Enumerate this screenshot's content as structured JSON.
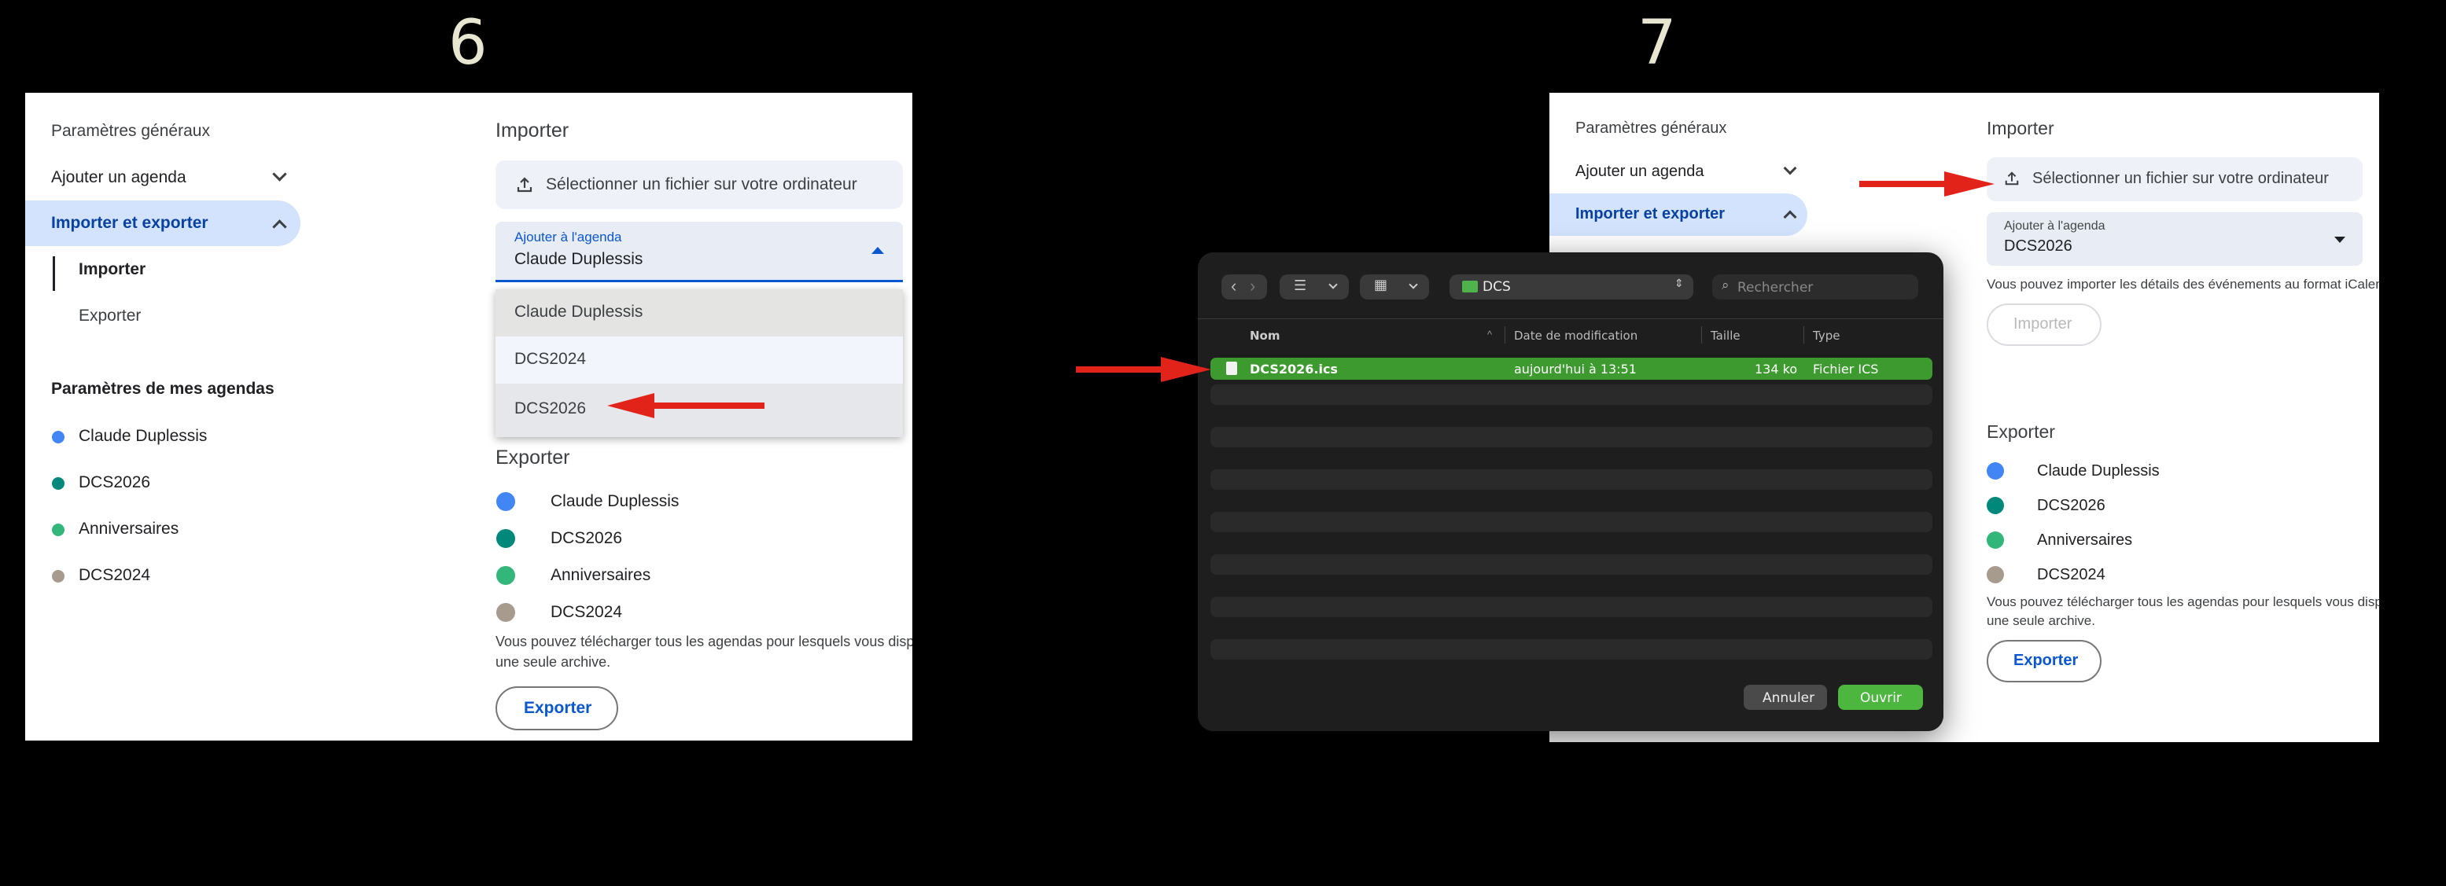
{
  "step6": {
    "number": "6",
    "sidebar": {
      "general": "Paramètres généraux",
      "add_calendar": "Ajouter un agenda",
      "import_export": "Importer et exporter",
      "import": "Importer",
      "export": "Exporter",
      "my_calendars_title": "Paramètres de mes agendas",
      "calendars": [
        "Claude Duplessis",
        "DCS2026",
        "Anniversaires",
        "DCS2024"
      ]
    },
    "import_title": "Importer",
    "upload_button": "Sélectionner un fichier sur votre ordinateur",
    "select_label": "Ajouter à l'agenda",
    "select_value": "Claude Duplessis",
    "dropdown_options": [
      "Claude Duplessis",
      "DCS2024",
      "DCS2026"
    ],
    "export_title": "Exporter",
    "export_calendars": [
      "Claude Duplessis",
      "DCS2026",
      "Anniversaires",
      "DCS2024"
    ],
    "export_note_1": "Vous pouvez télécharger tous les agendas pour lesquels vous disp",
    "export_note_2": "une seule archive.",
    "export_button": "Exporter"
  },
  "step7": {
    "number": "7",
    "sidebar": {
      "general": "Paramètres généraux",
      "add_calendar": "Ajouter un agenda",
      "import_export": "Importer et exporter"
    },
    "import_title": "Importer",
    "upload_button": "Sélectionner un fichier sur votre ordinateur",
    "select_label": "Ajouter à l'agenda",
    "select_value": "DCS2026",
    "import_note": "Vous pouvez importer les détails des événements au format iCalenda",
    "import_button": "Importer",
    "export_title": "Exporter",
    "export_calendars": [
      "Claude Duplessis",
      "DCS2026",
      "Anniversaires",
      "DCS2024"
    ],
    "export_note_1": "Vous pouvez télécharger tous les agendas pour lesquels vous dispo",
    "export_note_2": "une seule archive.",
    "export_button": "Exporter"
  },
  "file_dialog": {
    "folder": "DCS",
    "search_placeholder": "Rechercher",
    "columns": {
      "name": "Nom",
      "modified": "Date de modification",
      "size": "Taille",
      "type": "Type"
    },
    "file": {
      "name": "DCS2026.ics",
      "modified": "aujourd'hui à 13:51",
      "size": "134 ko",
      "type": "Fichier ICS"
    },
    "cancel": "Annuler",
    "open": "Ouvrir"
  },
  "colors": {
    "accent_blue": "#0b57d0",
    "selected_nav": "#d3e3fd",
    "dialog_selection": "#3d9a2f",
    "open_button": "#4cb63f",
    "arrow_red": "#e2231a"
  }
}
